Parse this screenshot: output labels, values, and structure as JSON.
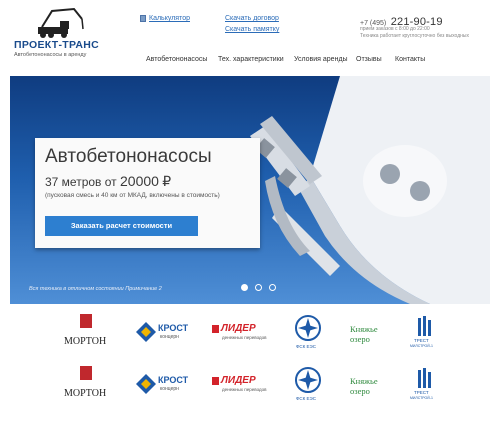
{
  "header": {
    "logo_title": "ПРОЕКТ-ТРАНС",
    "logo_subtitle": "Автобетононасосы в аренду",
    "calculator_link": "Калькулятор",
    "download_contract_link": "Скачать договор",
    "download_memo_link": "Скачать памятку",
    "phone_code": "+7 (495)",
    "phone_number": "221-90-19",
    "hours": "прием заказов с 8:00 до 22:00",
    "tech_note": "Техника работает круглосуточно без выходных"
  },
  "nav": {
    "items": [
      "Автобетононасосы",
      "Тех. характеристики",
      "Условия аренды",
      "Отзывы",
      "Контакты"
    ]
  },
  "hero": {
    "title": "Автобетононасосы",
    "price_prefix": "37 метров от",
    "price_value": "20000",
    "currency": "₽",
    "note": "(пусковая смесь и 40 км от МКАД, включены в стоимость)",
    "button_label": "Заказать расчет стоимости",
    "caption": "Вся техника в отличном состоянии Примичание 2",
    "slides_total": 3,
    "active_slide": 1,
    "colors": {
      "button": "#2d7fd0",
      "sky_top": "#0f3c80",
      "sky_bottom": "#4f8fd6"
    }
  },
  "partners": {
    "morton": "МОРТОН",
    "krost": "КРОСТ",
    "krost_sub": "концерн",
    "lider": "ЛИДЕР",
    "lider_sub": "денежных переводов",
    "fsk": "ФСК ЕЭС",
    "knyazhie": "Княжье",
    "ozero": "озеро",
    "trest": "ТРЕСТ",
    "trest_sub": "МИЛСТРОЙ-1"
  }
}
